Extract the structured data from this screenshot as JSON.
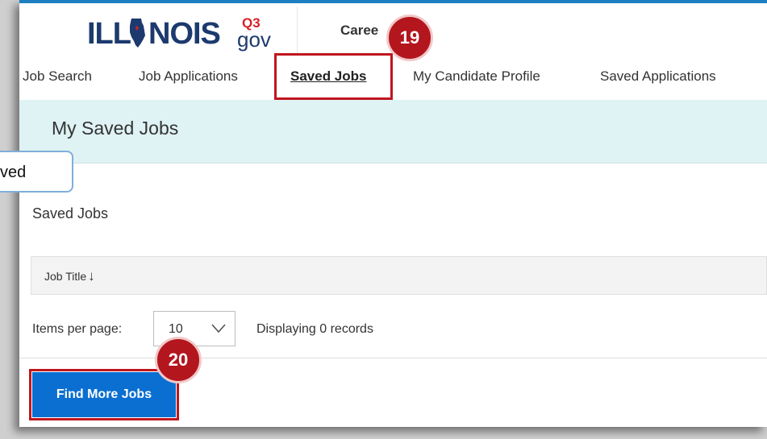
{
  "header": {
    "logo_illi": "ILL",
    "logo_nois": "NOIS",
    "logo_q3": "Q3",
    "logo_gov": "gov",
    "careers": "Caree"
  },
  "nav": {
    "items": [
      {
        "label": "Job Search"
      },
      {
        "label": "Job Applications"
      },
      {
        "label": "Saved Jobs",
        "active": true
      },
      {
        "label": "My Candidate Profile"
      },
      {
        "label": "Saved Applications"
      }
    ]
  },
  "banner": {
    "title": "My Saved Jobs"
  },
  "saved_jobs": {
    "section_title": "Saved Jobs",
    "columns": [
      {
        "label": "Job Title",
        "sort": "descending"
      }
    ],
    "rows": [],
    "items_per_page_label": "Items per page:",
    "items_per_page_value": "10",
    "displaying_text": "Displaying 0 records"
  },
  "actions": {
    "find_more_jobs": "Find More Jobs"
  },
  "annotations": {
    "step_19": "19",
    "step_20": "20",
    "tooltip_fragment": "ved"
  },
  "colors": {
    "brand_navy": "#1c3a6e",
    "accent_blue": "#0a6fd1",
    "banner_bg": "#dff2f4",
    "annotation_red": "#b4161e"
  }
}
